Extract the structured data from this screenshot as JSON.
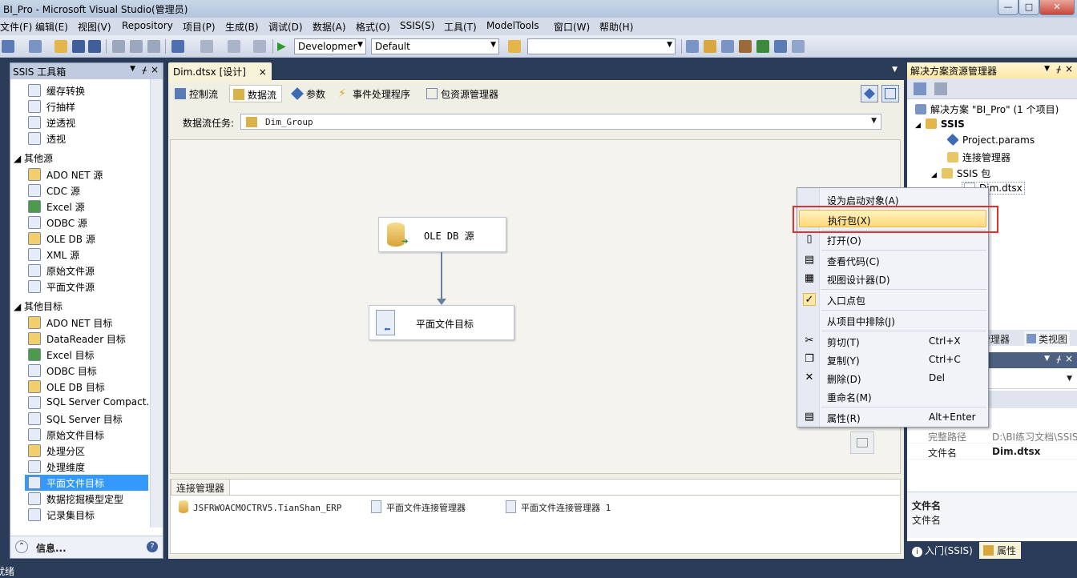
{
  "window": {
    "title": "BI_Pro - Microsoft Visual Studio(管理员)",
    "min": "—",
    "max": "□",
    "close": "✕"
  },
  "menu": [
    "文件(F)",
    "编辑(E)",
    "视图(V)",
    "Repository",
    "项目(P)",
    "生成(B)",
    "调试(D)",
    "数据(A)",
    "格式(O)",
    "SSIS(S)",
    "工具(T)",
    "ModelTools",
    "窗口(W)",
    "帮助(H)"
  ],
  "toolbar": {
    "config": "Developmer",
    "platform": "Default",
    "find": ""
  },
  "toolbox": {
    "title": "SSIS 工具箱",
    "items_top": [
      "缓存转换",
      "行抽样",
      "逆透视",
      "透视"
    ],
    "group_sources": "其他源",
    "sources": [
      "ADO NET 源",
      "CDC 源",
      "Excel 源",
      "ODBC 源",
      "OLE DB 源",
      "XML 源",
      "原始文件源",
      "平面文件源"
    ],
    "group_targets": "其他目标",
    "targets": [
      "ADO NET 目标",
      "DataReader 目标",
      "Excel 目标",
      "ODBC 目标",
      "OLE DB 目标",
      "SQL Server Compact...",
      "SQL Server 目标",
      "原始文件目标",
      "处理分区",
      "处理维度",
      "平面文件目标",
      "数据挖掘模型定型",
      "记录集目标"
    ],
    "info": "信息..."
  },
  "document": {
    "tab": "Dim.dtsx [设计]",
    "close": "×",
    "designer_tabs": [
      "控制流",
      "数据流",
      "参数",
      "事件处理程序",
      "包资源管理器"
    ],
    "task_label": "数据流任务:",
    "task_value": "Dim_Group",
    "nodes": {
      "source": "OLE DB 源",
      "dest": "平面文件目标"
    },
    "conn_tab": "连接管理器",
    "connections": [
      "JSFRWOACMOCTRV5.TianShan_ERP",
      "平面文件连接管理器",
      "平面文件连接管理器 1"
    ]
  },
  "context_menu": [
    {
      "label": "设为启动对象(A)",
      "shortcut": ""
    },
    {
      "label": "执行包(X)",
      "shortcut": ""
    },
    {
      "label": "打开(O)",
      "shortcut": ""
    },
    {
      "label": "查看代码(C)",
      "shortcut": ""
    },
    {
      "label": "视图设计器(D)",
      "shortcut": ""
    },
    {
      "label": "入口点包",
      "shortcut": ""
    },
    {
      "label": "从项目中排除(J)",
      "shortcut": ""
    },
    {
      "label": "剪切(T)",
      "shortcut": "Ctrl+X"
    },
    {
      "label": "复制(Y)",
      "shortcut": "Ctrl+C"
    },
    {
      "label": "删除(D)",
      "shortcut": "Del"
    },
    {
      "label": "重命名(M)",
      "shortcut": ""
    },
    {
      "label": "属性(R)",
      "shortcut": "Alt+Enter"
    }
  ],
  "solution": {
    "title": "解决方案资源管理器",
    "root": "解决方案 \"BI_Pro\" (1 个项目)",
    "project": "SSIS",
    "params": "Project.params",
    "conn_mgr": "连接管理器",
    "packages": "SSIS 包",
    "package": "Dim.dtsx",
    "tab_explorer": "管理器",
    "tab_class": "类视图",
    "props": {
      "full_path_label": "完整路径",
      "full_path_value": "D:\\BI练习文档\\SSIS",
      "filename_label": "文件名",
      "filename_value": "Dim.dtsx"
    },
    "desc_title": "文件名",
    "desc_text": "文件名",
    "bottom_tabs": [
      "入门(SSIS)",
      "属性"
    ]
  },
  "status": {
    "text": "就绪"
  },
  "colors": {
    "highlight_box": "#e03030",
    "accent": "#3399ff"
  }
}
